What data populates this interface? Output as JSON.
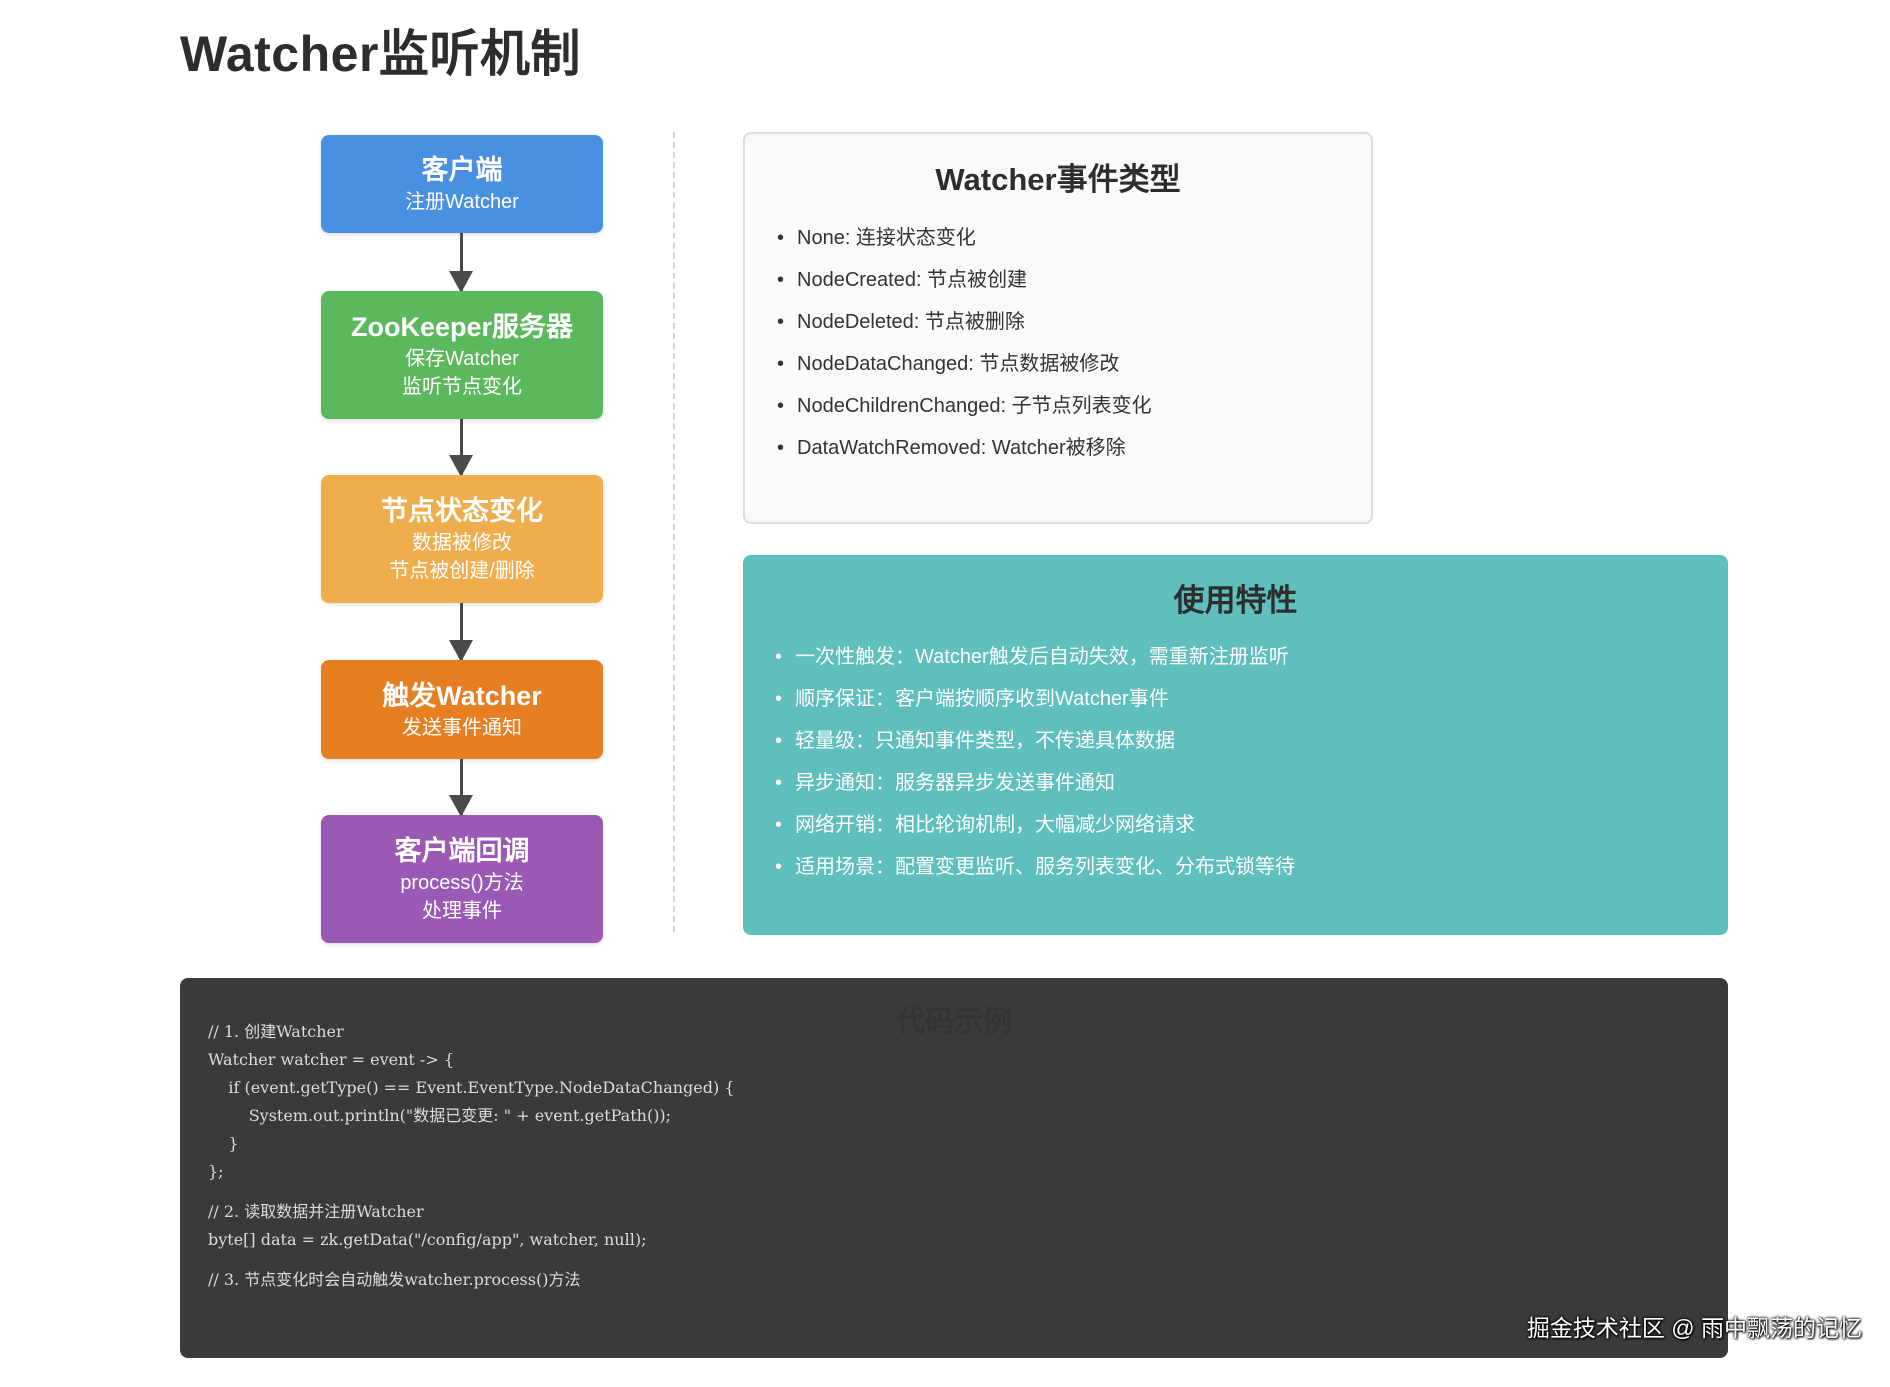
{
  "title": "Watcher监听机制",
  "flow": [
    {
      "title": "客户端",
      "lines": [
        "注册Watcher"
      ],
      "color": "#4a90e2"
    },
    {
      "title": "ZooKeeper服务器",
      "lines": [
        "保存Watcher",
        "监听节点变化"
      ],
      "color": "#5cb85c"
    },
    {
      "title": "节点状态变化",
      "lines": [
        "数据被修改",
        "节点被创建/删除"
      ],
      "color": "#f0ad4e"
    },
    {
      "title": "触发Watcher",
      "lines": [
        "发送事件通知"
      ],
      "color": "#e67e22"
    },
    {
      "title": "客户端回调",
      "lines": [
        "process()方法",
        "处理事件"
      ],
      "color": "#9b59b6"
    }
  ],
  "events_panel": {
    "title": "Watcher事件类型",
    "items": [
      "None: 连接状态变化",
      "NodeCreated: 节点被创建",
      "NodeDeleted: 节点被删除",
      "NodeDataChanged: 节点数据被修改",
      "NodeChildrenChanged: 子节点列表变化",
      "DataWatchRemoved: Watcher被移除"
    ]
  },
  "features_panel": {
    "title": "使用特性",
    "items": [
      "一次性触发：Watcher触发后自动失效，需重新注册监听",
      "顺序保证：客户端按顺序收到Watcher事件",
      "轻量级：只通知事件类型，不传递具体数据",
      "异步通知：服务器异步发送事件通知",
      "网络开销：相比轮询机制，大幅减少网络请求",
      "适用场景：配置变更监听、服务列表变化、分布式锁等待"
    ],
    "color": "#5ebfbd"
  },
  "code_panel": {
    "title": "代码示例",
    "lines": [
      "// 1. 创建Watcher",
      "Watcher watcher = event -> {",
      "    if (event.getType() == Event.EventType.NodeDataChanged) {",
      "        System.out.println(\"数据已变更: \" + event.getPath());",
      "    }",
      "};",
      "",
      "// 2. 读取数据并注册Watcher",
      "byte[] data = zk.getData(\"/config/app\", watcher, null);",
      "",
      "// 3. 节点变化时会自动触发watcher.process()方法"
    ]
  },
  "watermark": "掘金技术社区 @ 雨中飘荡的记忆"
}
